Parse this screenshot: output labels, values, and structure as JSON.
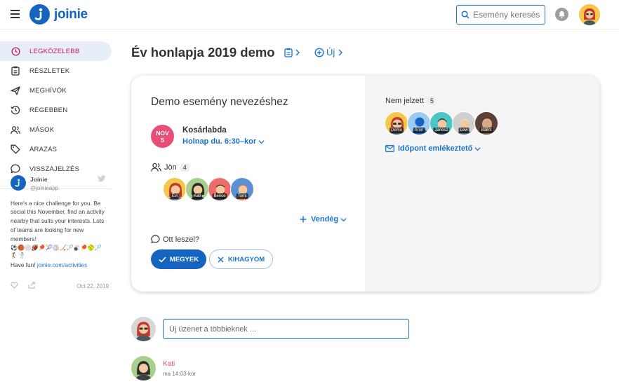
{
  "header": {
    "logo_text": "joinie",
    "search_placeholder": "Esemény keresés"
  },
  "sidebar": {
    "items": [
      {
        "label": "LEGKÖZELEBB",
        "icon": "clock-icon",
        "active": true
      },
      {
        "label": "RÉSZLETEK",
        "icon": "clipboard-icon",
        "active": false
      },
      {
        "label": "MEGHÍVÓK",
        "icon": "send-icon",
        "active": false
      },
      {
        "label": "RÉGEBBEN",
        "icon": "history-icon",
        "active": false
      },
      {
        "label": "MÁSOK",
        "icon": "people-icon",
        "active": false
      },
      {
        "label": "ÁRAZÁS",
        "icon": "tag-icon",
        "active": false
      },
      {
        "label": "VISSZAJELZÉS",
        "icon": "chat-bubble-icon",
        "active": false
      }
    ],
    "tweet": {
      "name": "Joinie",
      "handle": "@joinieapp",
      "text": "Here's a nice challenge for you. Be social this November, find an activity nearby that suits your interests. Lots of teams are looking for new members!",
      "emojis": "⚽🏀⚪🏈🏓🎾🏐🏒🏸🎳🏓🥎🏸",
      "emojis2": "🏌🤺",
      "fun_prefix": "Have fun!",
      "link": "joinie.com/activities",
      "date": "Oct 22, 2019"
    }
  },
  "main": {
    "title": "Év honlapja 2019 demo",
    "new_label": "Új"
  },
  "event": {
    "title": "Demo esemény nevezéshez",
    "month": "NOV",
    "day": "5",
    "activity": "Kosárlabda",
    "time": "Holnap du. 6:30–kor",
    "going_label": "Jön",
    "going_count": "4",
    "going": [
      {
        "name": "Évi",
        "bg": "#f5c84c"
      },
      {
        "name": "Kati",
        "bg": "#a8d08d"
      },
      {
        "name": "Bence",
        "bg": "#ef6c6c"
      },
      {
        "name": "Tomi",
        "bg": "#5b8fd6"
      }
    ],
    "guest_label": "Vendég",
    "question": "Ott leszel?",
    "go_label": "MEGYEK",
    "skip_label": "KIHAGYOM",
    "not_marked_label": "Nem jelzett",
    "not_marked_count": "5",
    "not_marked": [
      {
        "name": "Demo",
        "bg": "#f5c84c"
      },
      {
        "name": "Áron",
        "bg": "#9ccaf0"
      },
      {
        "name": "János2",
        "bg": "#4cc6c6"
      },
      {
        "name": "Levi",
        "bg": "#cfcfcf"
      },
      {
        "name": "Bálint",
        "bg": "#8d6e63"
      }
    ],
    "reminder_label": "Időpont emlékeztető"
  },
  "messages": {
    "composer_placeholder": "Új üzenet a többieknek ...",
    "first": {
      "author": "Kati",
      "time": "ma 14:03-kor"
    }
  },
  "colors": {
    "accent": "#1976d2",
    "brand": "#1565c0",
    "pink": "#e94e77"
  }
}
